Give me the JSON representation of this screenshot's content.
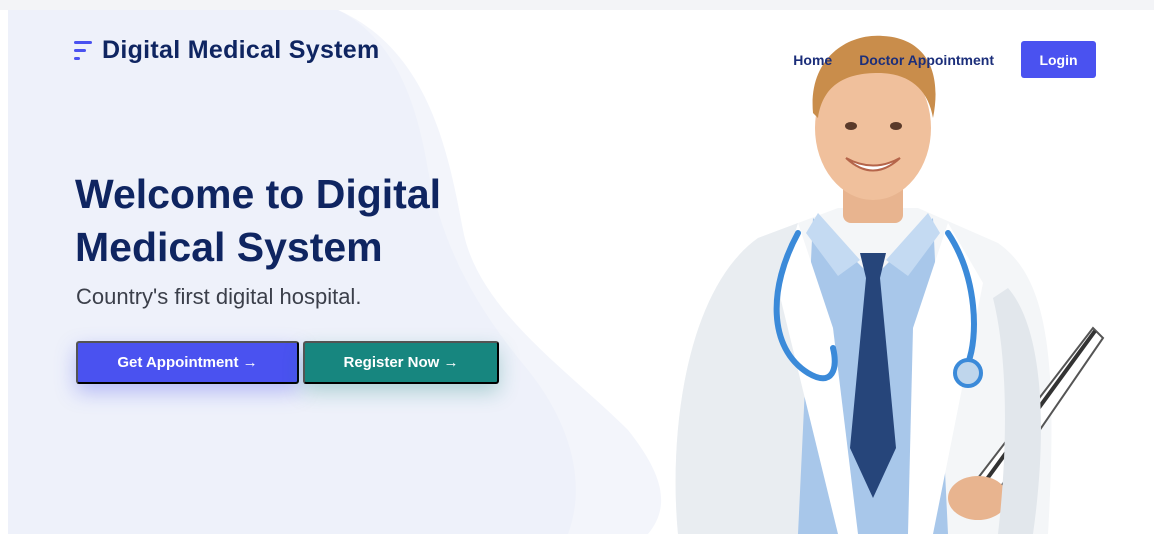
{
  "brand": {
    "name": "Digital Medical System",
    "color": "#4a52f0",
    "icon": "menu-lines-icon"
  },
  "nav": {
    "links": [
      "Home",
      "Doctor Appointment"
    ],
    "login_label": "Login"
  },
  "hero": {
    "title": "Welcome to Digital Medical System",
    "subtitle": "Country's first digital hospital.",
    "primary_button": "Get Appointment →",
    "secondary_button": "Register Now →"
  },
  "colors": {
    "primary": "#4a52f0",
    "secondary": "#17867f",
    "heading": "#0f2561"
  },
  "image": {
    "subject": "doctor-photo"
  }
}
